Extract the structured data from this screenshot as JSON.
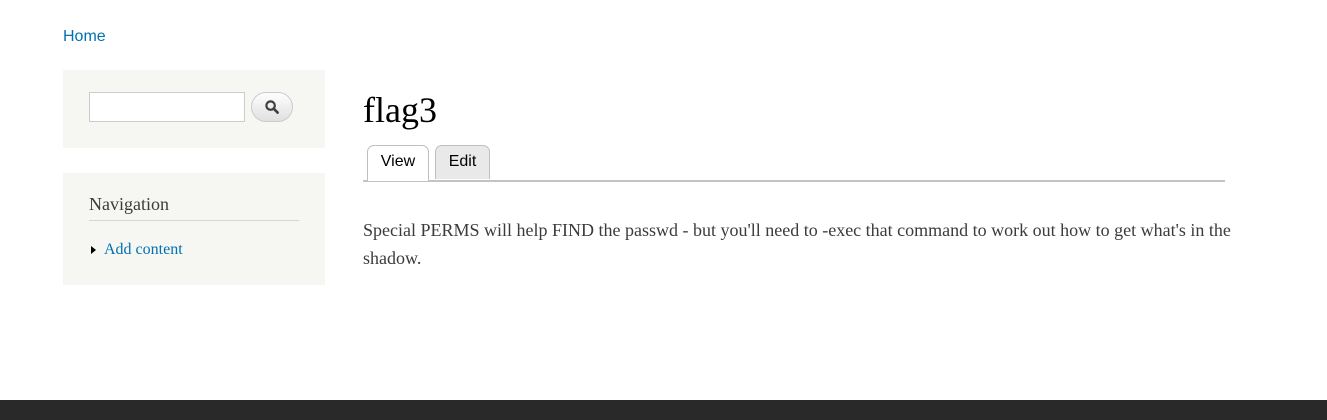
{
  "breadcrumb": {
    "home_label": "Home"
  },
  "search": {
    "value": "",
    "placeholder": "",
    "button_icon": "search-icon"
  },
  "navigation": {
    "title": "Navigation",
    "items": [
      {
        "label": "Add content"
      }
    ]
  },
  "page": {
    "title": "flag3",
    "tabs": [
      {
        "label": "View",
        "active": true
      },
      {
        "label": "Edit",
        "active": false
      }
    ],
    "body": "Special PERMS will help FIND the passwd - but you'll need to -exec that command to work out how to get what's in the shadow."
  },
  "colors": {
    "link": "#0071b3",
    "sidebar_background": "#f6f6f2",
    "footer": "#292929"
  }
}
